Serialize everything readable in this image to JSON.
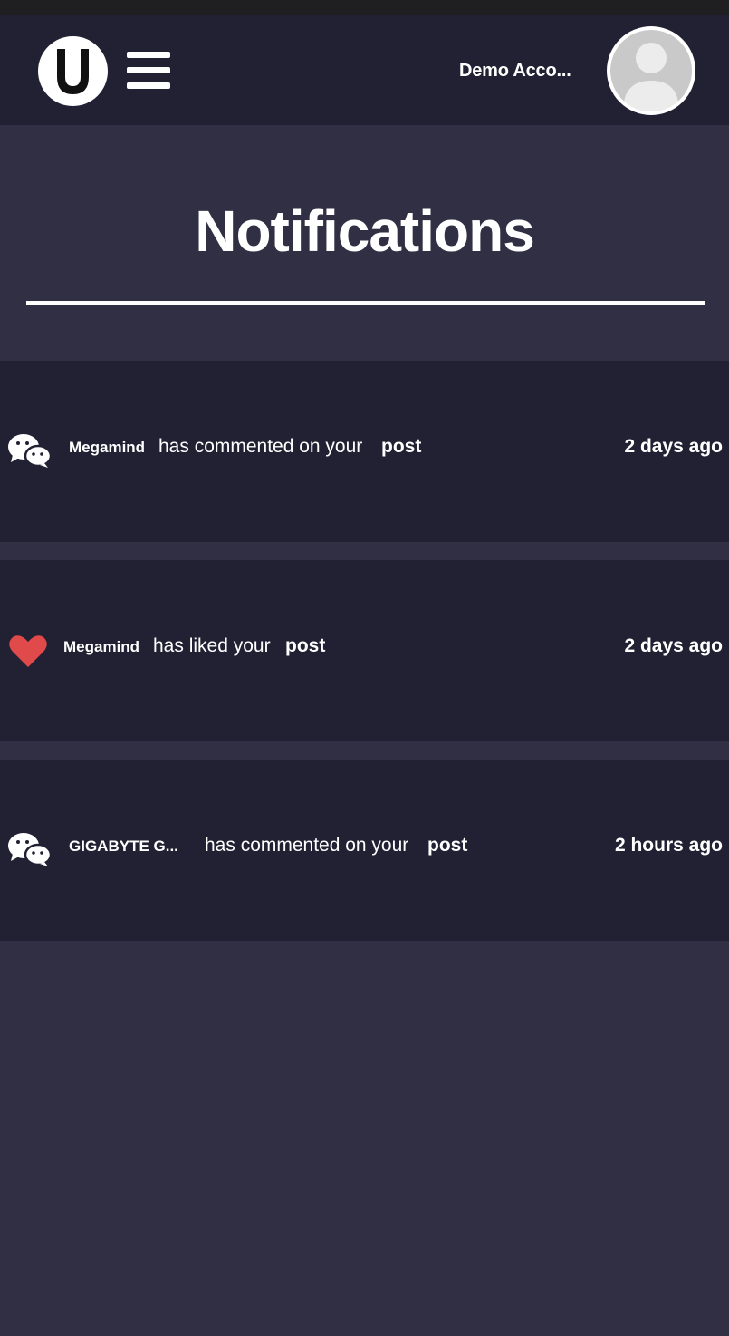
{
  "header": {
    "logo_letter": "U",
    "account_name": "Demo Acco..."
  },
  "page": {
    "title": "Notifications"
  },
  "notifications": [
    {
      "type": "comment",
      "icon": "chat-icon",
      "user": "Megamind",
      "action": "has commented on your",
      "target": "post",
      "time": "2 days ago"
    },
    {
      "type": "like",
      "icon": "heart-icon",
      "user": "Megamind",
      "action": "has liked your",
      "target": "post",
      "time": "2 days ago"
    },
    {
      "type": "comment",
      "icon": "chat-icon",
      "user": "GIGABYTE G...",
      "action": "has commented on your",
      "target": "post",
      "time": "2 hours ago"
    }
  ],
  "colors": {
    "background": "#312f43",
    "header": "#222133",
    "card": "#222133",
    "heart": "#e04a4a"
  }
}
